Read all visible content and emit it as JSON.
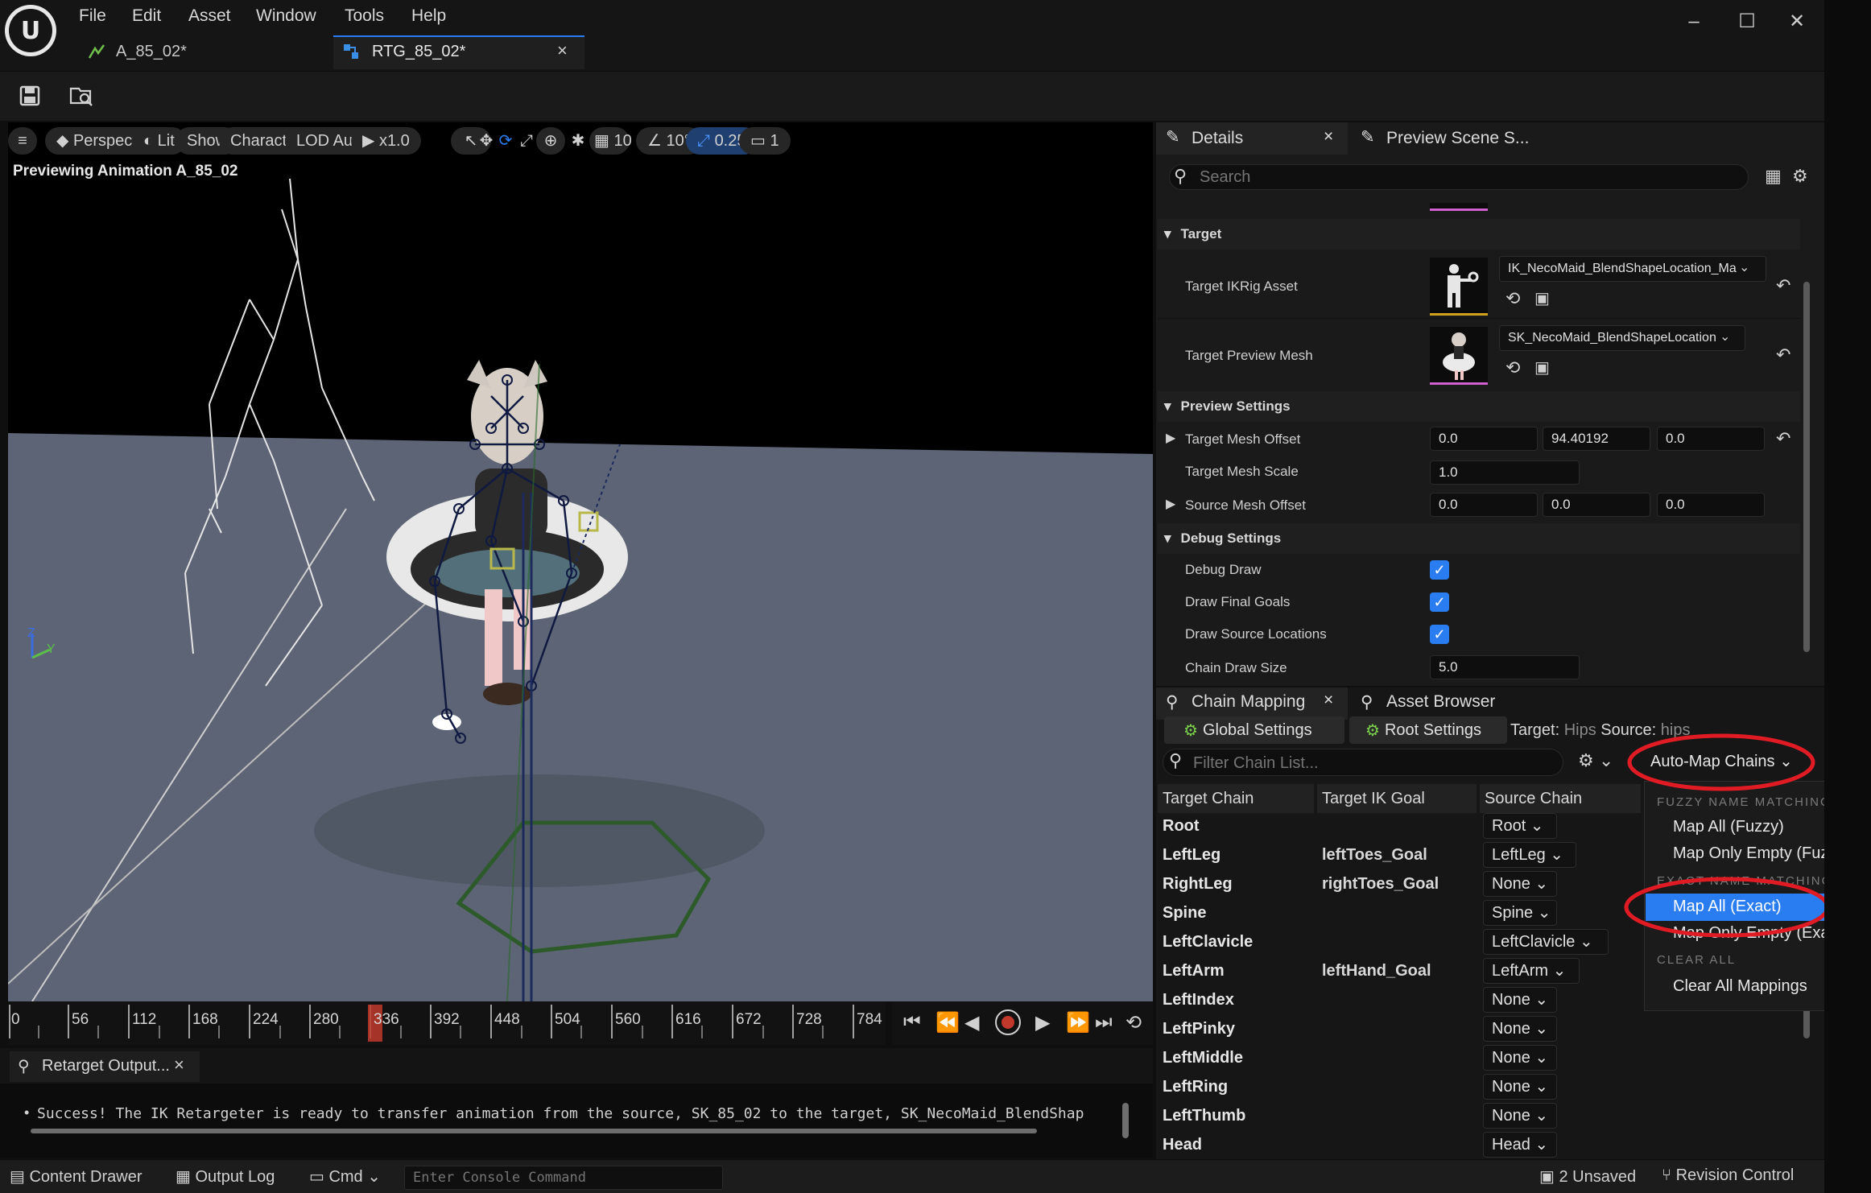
{
  "window": {
    "menus": [
      "File",
      "Edit",
      "Asset",
      "Window",
      "Tools",
      "Help"
    ],
    "tabs": [
      {
        "label": "A_85_02*",
        "active": false
      },
      {
        "label": "RTG_85_02*",
        "active": true
      }
    ]
  },
  "viewport": {
    "toolbar": {
      "perspective": "Perspective",
      "lit": "Lit",
      "show": "Show",
      "character": "Character",
      "lod": "LOD Auto",
      "play_speed": "x1.0",
      "grid_size": "10",
      "angle_snap": "10°",
      "scale_snap": "0.25",
      "camera_speed": "1"
    },
    "preview_label": "Previewing Animation A_85_02",
    "axis": {
      "z": "Z",
      "y": "Y"
    }
  },
  "timeline": {
    "ticks": [
      "0",
      "56",
      "112",
      "168",
      "224",
      "280",
      "336",
      "392",
      "448",
      "504",
      "560",
      "616",
      "672",
      "728",
      "784"
    ],
    "playhead_fraction": 0.41
  },
  "output": {
    "tab": "Retarget Output...",
    "message": "Success! The IK Retargeter is ready to transfer animation from the source, SK_85_02 to the target, SK_NecoMaid_BlendShap"
  },
  "statusbar": {
    "content_drawer": "Content Drawer",
    "output_log": "Output Log",
    "cmd": "Cmd",
    "console_placeholder": "Enter Console Command",
    "unsaved": "2 Unsaved",
    "revision_control": "Revision Control"
  },
  "details": {
    "tabs": [
      "Details",
      "Preview Scene S..."
    ],
    "search_placeholder": "Search",
    "sections": {
      "target": "Target",
      "preview": "Preview Settings",
      "debug": "Debug Settings"
    },
    "target_ikrig_label": "Target IKRig Asset",
    "target_ikrig_value": "IK_NecoMaid_BlendShapeLocation_Ma",
    "target_mesh_label": "Target Preview Mesh",
    "target_mesh_value": "SK_NecoMaid_BlendShapeLocation",
    "target_mesh_offset_label": "Target Mesh Offset",
    "target_mesh_offset": [
      "0.0",
      "94.40192",
      "0.0"
    ],
    "target_mesh_scale_label": "Target Mesh Scale",
    "target_mesh_scale": "1.0",
    "source_mesh_offset_label": "Source Mesh Offset",
    "source_mesh_offset": [
      "0.0",
      "0.0",
      "0.0"
    ],
    "debug_draw_label": "Debug Draw",
    "draw_final_goals_label": "Draw Final Goals",
    "draw_source_locations_label": "Draw Source Locations",
    "chain_draw_size_label": "Chain Draw Size",
    "chain_draw_size": "5.0"
  },
  "chain_mapping": {
    "tabs": [
      "Chain Mapping",
      "Asset Browser"
    ],
    "global_settings": "Global Settings",
    "root_settings": "Root Settings",
    "target_label": "Target:",
    "target_value": "Hips",
    "source_label": "Source:",
    "source_value": "hips",
    "filter_placeholder": "Filter Chain List...",
    "auto_map": "Auto-Map Chains",
    "columns": [
      "Target Chain",
      "Target IK Goal",
      "Source Chain"
    ],
    "rows": [
      {
        "chain": "Root",
        "goal": "",
        "source": "Root"
      },
      {
        "chain": "LeftLeg",
        "goal": "leftToes_Goal",
        "source": "LeftLeg"
      },
      {
        "chain": "RightLeg",
        "goal": "rightToes_Goal",
        "source": "None"
      },
      {
        "chain": "Spine",
        "goal": "",
        "source": "Spine"
      },
      {
        "chain": "LeftClavicle",
        "goal": "",
        "source": "LeftClavicle"
      },
      {
        "chain": "LeftArm",
        "goal": "leftHand_Goal",
        "source": "LeftArm"
      },
      {
        "chain": "LeftIndex",
        "goal": "",
        "source": "None"
      },
      {
        "chain": "LeftPinky",
        "goal": "",
        "source": "None"
      },
      {
        "chain": "LeftMiddle",
        "goal": "",
        "source": "None"
      },
      {
        "chain": "LeftRing",
        "goal": "",
        "source": "None"
      },
      {
        "chain": "LeftThumb",
        "goal": "",
        "source": "None"
      },
      {
        "chain": "Head",
        "goal": "",
        "source": "Head"
      }
    ]
  },
  "automap_menu": {
    "fuzzy_section": "FUZZY NAME MATCHING",
    "map_all_fuzzy": "Map All (Fuzzy)",
    "map_empty_fuzzy": "Map Only Empty (Fuzzy)",
    "exact_section": "EXACT NAME MATCHING",
    "map_all_exact": "Map All (Exact)",
    "map_empty_exact": "Map Only Empty (Exact)",
    "clear_section": "CLEAR ALL",
    "clear_all": "Clear All Mappings"
  },
  "colors": {
    "accent": "#2a7df0",
    "highlight_red": "#e01b24",
    "viewport_floor": "#5d6475",
    "timeline_marker": "#c0392b"
  }
}
